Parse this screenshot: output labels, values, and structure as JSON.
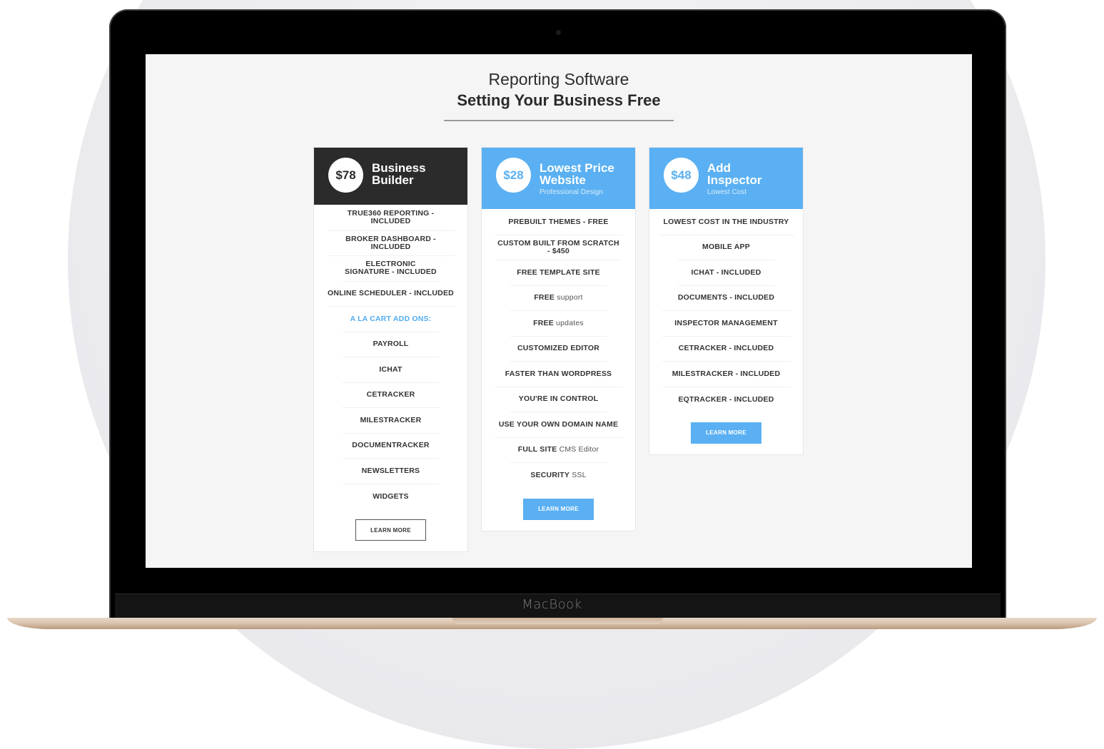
{
  "device": {
    "brand": "MacBook"
  },
  "header": {
    "line1": "Reporting Software",
    "line2": "Setting Your Business Free"
  },
  "plans": [
    {
      "price": "$78",
      "name": "Business Builder",
      "subtitle": "",
      "features": [
        "TRUE360 REPORTING - INCLUDED",
        "BROKER DASHBOARD - INCLUDED",
        "ELECTRONIC SIGNATURE - INCLUDED",
        "ONLINE SCHEDULER - INCLUDED",
        "A LA CART ADD ONS:",
        "PAYROLL",
        "ICHAT",
        "CETRACKER",
        "MILESTRACKER",
        "DOCUMENTRACKER",
        "NEWSLETTERS",
        "WIDGETS"
      ],
      "button": "LEARN MORE"
    },
    {
      "price": "$28",
      "name": "Lowest Price Website",
      "subtitle": "Professional Design",
      "features": [
        "PREBUILT THEMES - FREE",
        "CUSTOM BUILT FROM SCRATCH - $450",
        "FREE TEMPLATE SITE",
        {
          "bold": "FREE",
          "normal": "support"
        },
        {
          "bold": "FREE",
          "normal": "updates"
        },
        "CUSTOMIZED EDITOR",
        "FASTER THAN WORDPRESS",
        "YOU'RE IN CONTROL",
        "USE YOUR OWN DOMAIN NAME",
        {
          "bold": "FULL SITE",
          "normal": "CMS Editor"
        },
        {
          "bold": "SECURITY",
          "normal": "SSL"
        }
      ],
      "button": "LEARN MORE"
    },
    {
      "price": "$48",
      "name": "Add Inspector",
      "subtitle": "Lowest Cost",
      "features": [
        "LOWEST COST IN THE INDUSTRY",
        "MOBILE APP",
        "ICHAT - INCLUDED",
        "DOCUMENTS - INCLUDED",
        "INSPECTOR MANAGEMENT",
        "CETRACKER - INCLUDED",
        "MILESTRACKER - INCLUDED",
        "EQTRACKER - INCLUDED"
      ],
      "button": "LEARN MORE"
    }
  ],
  "colors": {
    "accent": "#5ab0f2",
    "dark": "#2b2b2b",
    "screen_bg": "#f5f5f6"
  }
}
